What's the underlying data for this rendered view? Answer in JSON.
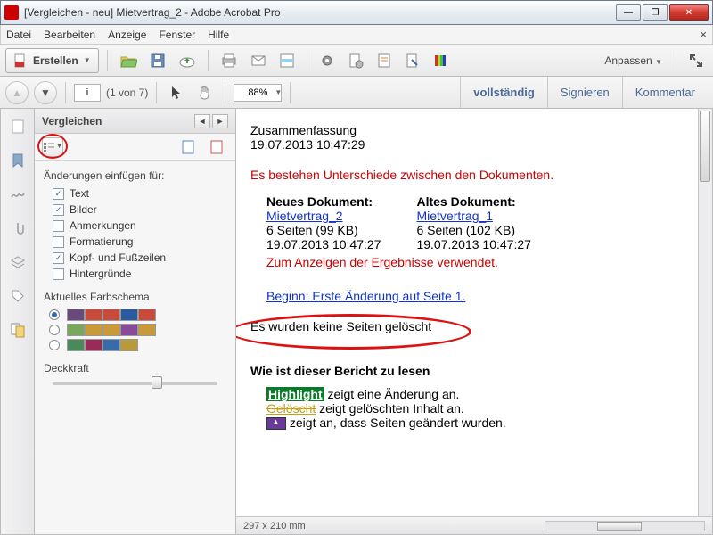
{
  "window": {
    "title": "[Vergleichen - neu] Mietvertrag_2 - Adobe Acrobat Pro"
  },
  "menu": {
    "file": "Datei",
    "edit": "Bearbeiten",
    "view": "Anzeige",
    "window": "Fenster",
    "help": "Hilfe"
  },
  "toolbar": {
    "create": "Erstellen",
    "customize": "Anpassen"
  },
  "nav": {
    "page_value": "i",
    "page_total": "(1 von 7)",
    "zoom": "88%"
  },
  "rightlinks": {
    "full": "vollständig",
    "sign": "Signieren",
    "comment": "Kommentar"
  },
  "panel": {
    "title": "Vergleichen",
    "insert_label": "Änderungen einfügen für:",
    "opt_text": "Text",
    "opt_images": "Bilder",
    "opt_annot": "Anmerkungen",
    "opt_format": "Formatierung",
    "opt_headfoot": "Kopf- und Fußzeilen",
    "opt_bg": "Hintergründe",
    "scheme_label": "Aktuelles Farbschema",
    "opacity_label": "Deckkraft"
  },
  "doc": {
    "summary_title": "Zusammenfassung",
    "summary_date": "19.07.2013 10:47:29",
    "diff_msg": "Es bestehen Unterschiede zwischen den Dokumenten.",
    "new_label": "Neues Dokument:",
    "new_link": "Mietvertrag_2",
    "new_pages": "6 Seiten (99 KB)",
    "new_date": "19.07.2013 10:47:27",
    "old_label": "Altes Dokument:",
    "old_link": "Mietvertrag_1",
    "old_pages": "6 Seiten (102 KB)",
    "old_date": "19.07.2013 10:47:27",
    "used_msg": "Zum Anzeigen der Ergebnisse verwendet.",
    "begin_link": "Beginn: Erste Änderung auf Seite 1.",
    "no_delete": "Es wurden keine Seiten gelöscht",
    "howto_title": "Wie ist dieser Bericht zu lesen",
    "hl_word": "Highlight",
    "hl_rest": " zeigt eine Änderung an.",
    "del_word": "Gelöscht",
    "del_rest": " zeigt gelöschten Inhalt an.",
    "moved_rest": " zeigt an, dass Seiten geändert wurden."
  },
  "status": {
    "dims": "297 x 210 mm"
  },
  "schemes": [
    [
      "#6a4a7a",
      "#c84a3a",
      "#c84a3a",
      "#2a5aa0",
      "#c84a3a"
    ],
    [
      "#7aa85a",
      "#c89a3a",
      "#c89a3a",
      "#8a4a9a",
      "#c89a3a"
    ],
    [
      "#4a8a5a",
      "#9a2a5a",
      "#3a6aa8",
      "#b89a3a"
    ]
  ]
}
